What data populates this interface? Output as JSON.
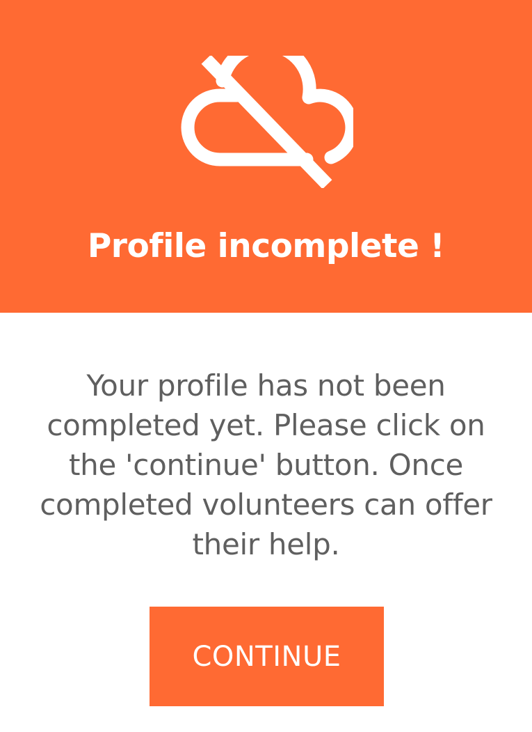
{
  "dialog": {
    "icon": "cloud-off-icon",
    "title": "Profile incomplete !",
    "message": "Your profile has not been completed yet. Please click on the 'continue' button. Once completed volunteers can offer their help.",
    "continue_label": "CONTINUE"
  },
  "colors": {
    "accent": "#ff6a33",
    "text": "#5f5f5f",
    "on_accent": "#ffffff"
  }
}
